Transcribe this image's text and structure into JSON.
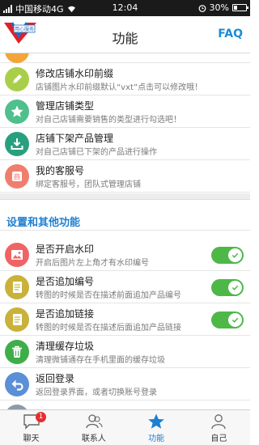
{
  "status_bar": {
    "carrier": "中国移动4G",
    "time": "12:04",
    "battery": "30%"
  },
  "header": {
    "title": "功能",
    "faq_label": "FAQ",
    "logo_text": "用心服务"
  },
  "shop_items": [
    {
      "title": "",
      "desc": "",
      "icon": "partial-item-icon",
      "color": "#f2a53a"
    },
    {
      "title": "修改店铺水印前缀",
      "desc": "店铺图片水印前缀默认“vxt”点击可以修改哦！",
      "icon": "pencil-icon",
      "color": "#a9cf4a"
    },
    {
      "title": "管理店铺类型",
      "desc": "对自己店铺需要销售的类型进行勾选吧！",
      "icon": "star-icon",
      "color": "#4fc08d"
    },
    {
      "title": "店铺下架产品管理",
      "desc": "对自己店铺已下架的产品进行操作",
      "icon": "download-tray-icon",
      "color": "#28a080"
    },
    {
      "title": "我的客服号",
      "desc": "绑定客服号，团队式管理店铺",
      "icon": "shop-icon",
      "color": "#f07e6e"
    }
  ],
  "section": {
    "title": "设置和其他功能"
  },
  "settings_items": [
    {
      "title": "是否开启水印",
      "desc": "开启后图片左上角才有水印编号",
      "icon": "picture-icon",
      "color": "#ef6464",
      "toggle": true
    },
    {
      "title": "是否追加编号",
      "desc": "转图的时候是否在描述前面追加产品编号",
      "icon": "document-icon",
      "color": "#c8b23a",
      "toggle": true
    },
    {
      "title": "是否追加链接",
      "desc": "转图的时候是否在描述后面追加产品链接",
      "icon": "document-icon",
      "color": "#c8b23a",
      "toggle": true
    },
    {
      "title": "清理缓存垃圾",
      "desc": "清理微铺通存在手机里面的缓存垃圾",
      "icon": "trash-icon",
      "color": "#3fae49",
      "toggle": false
    },
    {
      "title": "返回登录",
      "desc": "返回登录界面，或者切换账号登录",
      "icon": "back-arrow-icon",
      "color": "#5b8fd6",
      "toggle": false
    }
  ],
  "tabs": [
    {
      "label": "聊天",
      "badge": "1",
      "icon": "chat-icon"
    },
    {
      "label": "联系人",
      "icon": "contacts-icon"
    },
    {
      "label": "功能",
      "icon": "star-icon",
      "active": true
    },
    {
      "label": "自己",
      "icon": "person-icon"
    }
  ]
}
